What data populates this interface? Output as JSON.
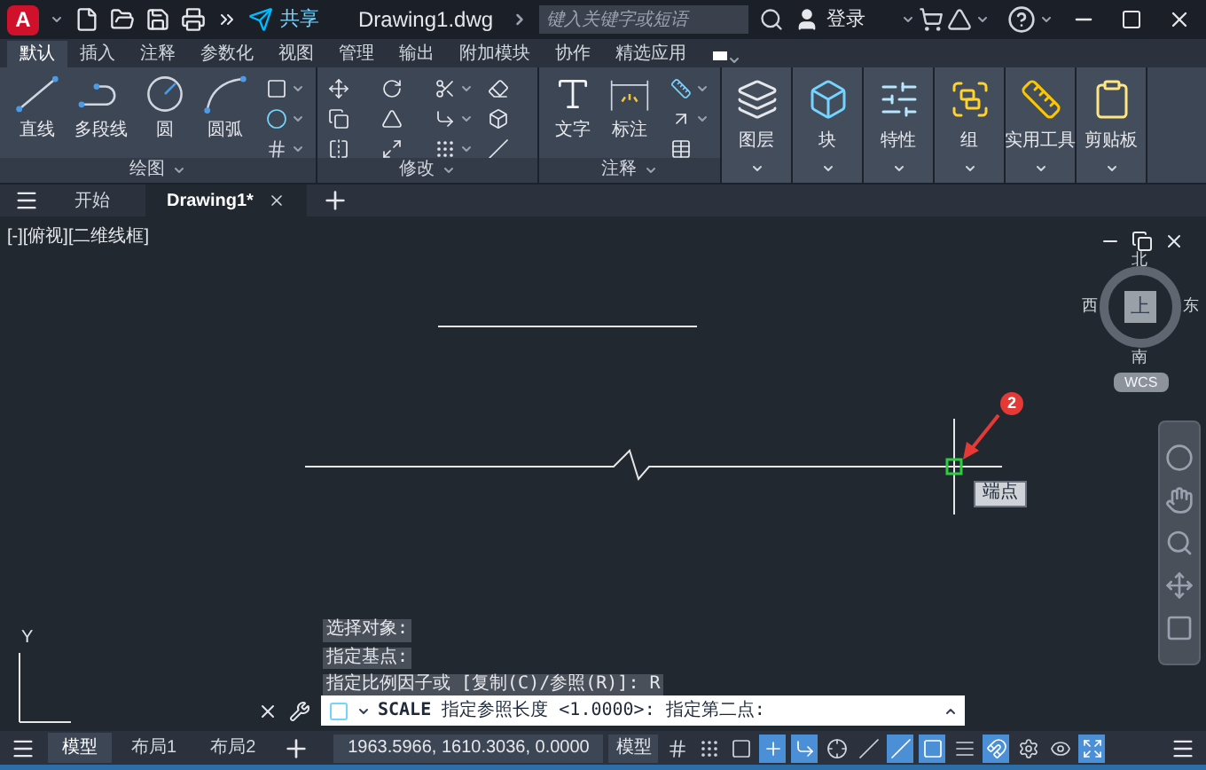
{
  "title_bar": {
    "logo": "A",
    "share": "共享",
    "filename": "Drawing1.dwg",
    "search": {
      "placeholder": "键入关键字或短语"
    },
    "login": "登录"
  },
  "ribbon_tabs": [
    {
      "label": "默认",
      "selected": true
    },
    {
      "label": "插入",
      "selected": false
    },
    {
      "label": "注释",
      "selected": false
    },
    {
      "label": "参数化",
      "selected": false
    },
    {
      "label": "视图",
      "selected": false
    },
    {
      "label": "管理",
      "selected": false
    },
    {
      "label": "输出",
      "selected": false
    },
    {
      "label": "附加模块",
      "selected": false
    },
    {
      "label": "协作",
      "selected": false
    },
    {
      "label": "精选应用",
      "selected": false
    }
  ],
  "ribbon_panels": [
    {
      "kind": "draw",
      "title": "绘图",
      "tools": [
        "直线",
        "多段线",
        "圆",
        "圆弧"
      ]
    },
    {
      "kind": "modify",
      "title": "修改"
    },
    {
      "kind": "annotate",
      "title": "注释",
      "tools": [
        "文字",
        "标注"
      ]
    }
  ],
  "large_buttons": [
    "图层",
    "块",
    "特性",
    "组",
    "实用工具",
    "剪贴板"
  ],
  "file_tabs": [
    {
      "label": "开始",
      "selected": false,
      "closable": false
    },
    {
      "label": "Drawing1*",
      "selected": true,
      "closable": true
    }
  ],
  "viewport": {
    "label": "[-][俯视][二维线框]",
    "compass": {
      "north": "北",
      "south": "南",
      "east": "东",
      "west": "西",
      "center": "上",
      "ucs": "WCS"
    },
    "snap_tooltip": "端点",
    "annotation_badge": "2",
    "ucs_axis_label": "Y"
  },
  "command_line": {
    "history": [
      "选择对象:",
      "指定基点:",
      "指定比例因子或 [复制(C)/参照(R)]: R"
    ],
    "command": "SCALE",
    "prompt": "指定参照长度 <1.0000>:  指定第二点:"
  },
  "layout_tabs": [
    {
      "label": "模型",
      "selected": true
    },
    {
      "label": "布局1",
      "selected": false
    },
    {
      "label": "布局2",
      "selected": false
    }
  ],
  "status_bar": {
    "coordinates": "1963.5966, 1610.3036, 0.0000",
    "space": "模型",
    "toggles": [
      {
        "kind": "grid",
        "on": false
      },
      {
        "kind": "snap",
        "on": false
      },
      {
        "kind": "infer",
        "on": false
      },
      {
        "kind": "dynamic_input",
        "on": true
      },
      {
        "kind": "ortho",
        "on": true
      },
      {
        "kind": "polar",
        "on": false
      },
      {
        "kind": "isometric",
        "on": false
      },
      {
        "kind": "tracking",
        "on": true
      },
      {
        "kind": "object_snap",
        "on": true
      },
      {
        "kind": "lineweight",
        "on": false
      },
      {
        "kind": "annotation",
        "on": true
      },
      {
        "kind": "workspace",
        "on": false
      },
      {
        "kind": "isolate",
        "on": false
      },
      {
        "kind": "fullscreen",
        "on": true
      }
    ]
  }
}
